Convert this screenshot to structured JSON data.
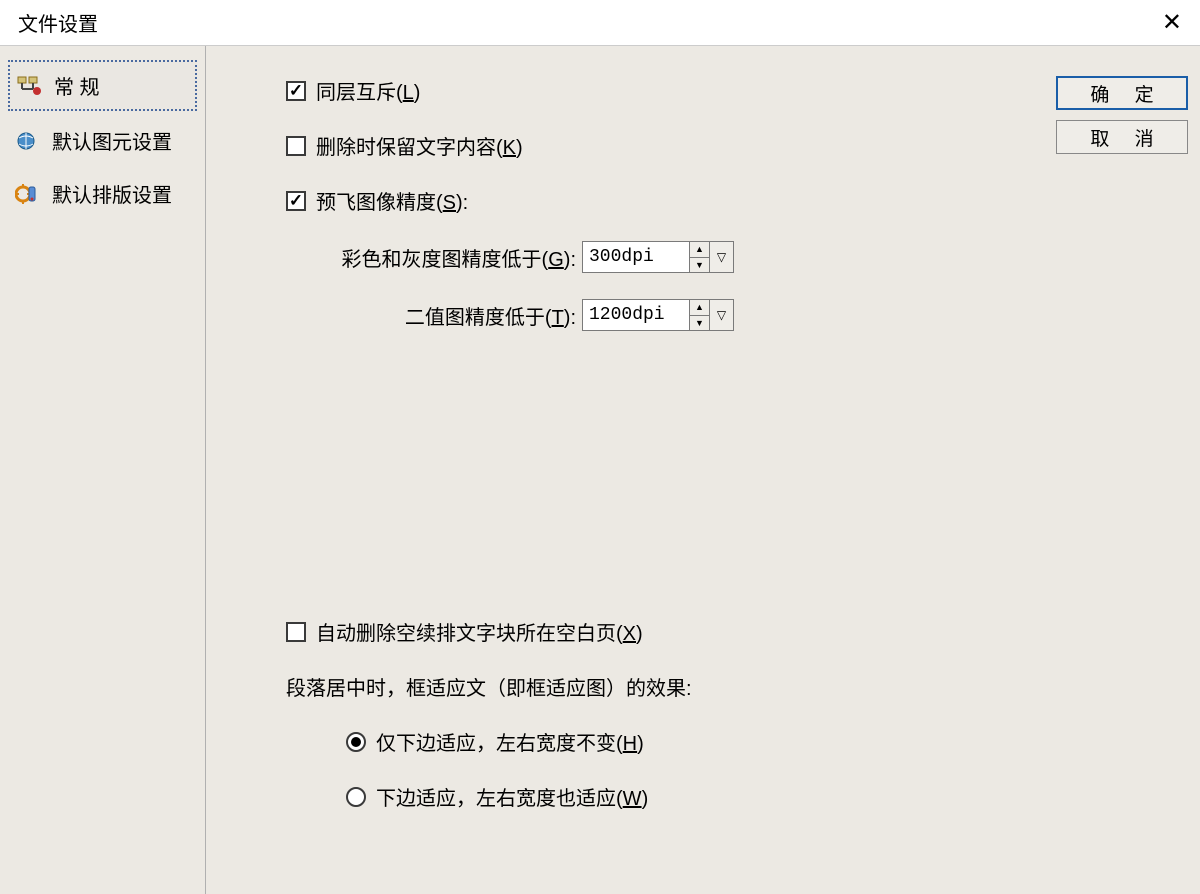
{
  "window": {
    "title": "文件设置"
  },
  "sidebar": {
    "items": [
      {
        "label": "常  规"
      },
      {
        "label": "默认图元设置"
      },
      {
        "label": "默认排版设置"
      }
    ]
  },
  "buttons": {
    "ok": "确 定",
    "cancel": "取 消"
  },
  "form": {
    "same_layer_exclusive": {
      "label": "同层互斥(",
      "hotkey": "L",
      "label2": ")",
      "checked": true
    },
    "keep_text_on_delete": {
      "label": "删除时保留文字内容(",
      "hotkey": "K",
      "label2": ")",
      "checked": false
    },
    "preflight_precision": {
      "label": "预飞图像精度(",
      "hotkey": "S",
      "label2": "):",
      "checked": true
    },
    "color_gray_precision": {
      "label": "彩色和灰度图精度低于(",
      "hotkey": "G",
      "label2": "):",
      "value": "300dpi"
    },
    "binary_precision": {
      "label": "二值图精度低于(",
      "hotkey": "T",
      "label2": "):",
      "value": "1200dpi"
    },
    "auto_delete_blank": {
      "label": "自动删除空续排文字块所在空白页(",
      "hotkey": "X",
      "label2": ")",
      "checked": false
    },
    "paragraph_center_text": "段落居中时，框适应文（即框适应图）的效果:",
    "radio_bottom_only": {
      "label": "仅下边适应，左右宽度不变(",
      "hotkey": "H",
      "label2": ")",
      "checked": true
    },
    "radio_bottom_and_width": {
      "label": "下边适应，左右宽度也适应(",
      "hotkey": "W",
      "label2": ")",
      "checked": false
    }
  }
}
